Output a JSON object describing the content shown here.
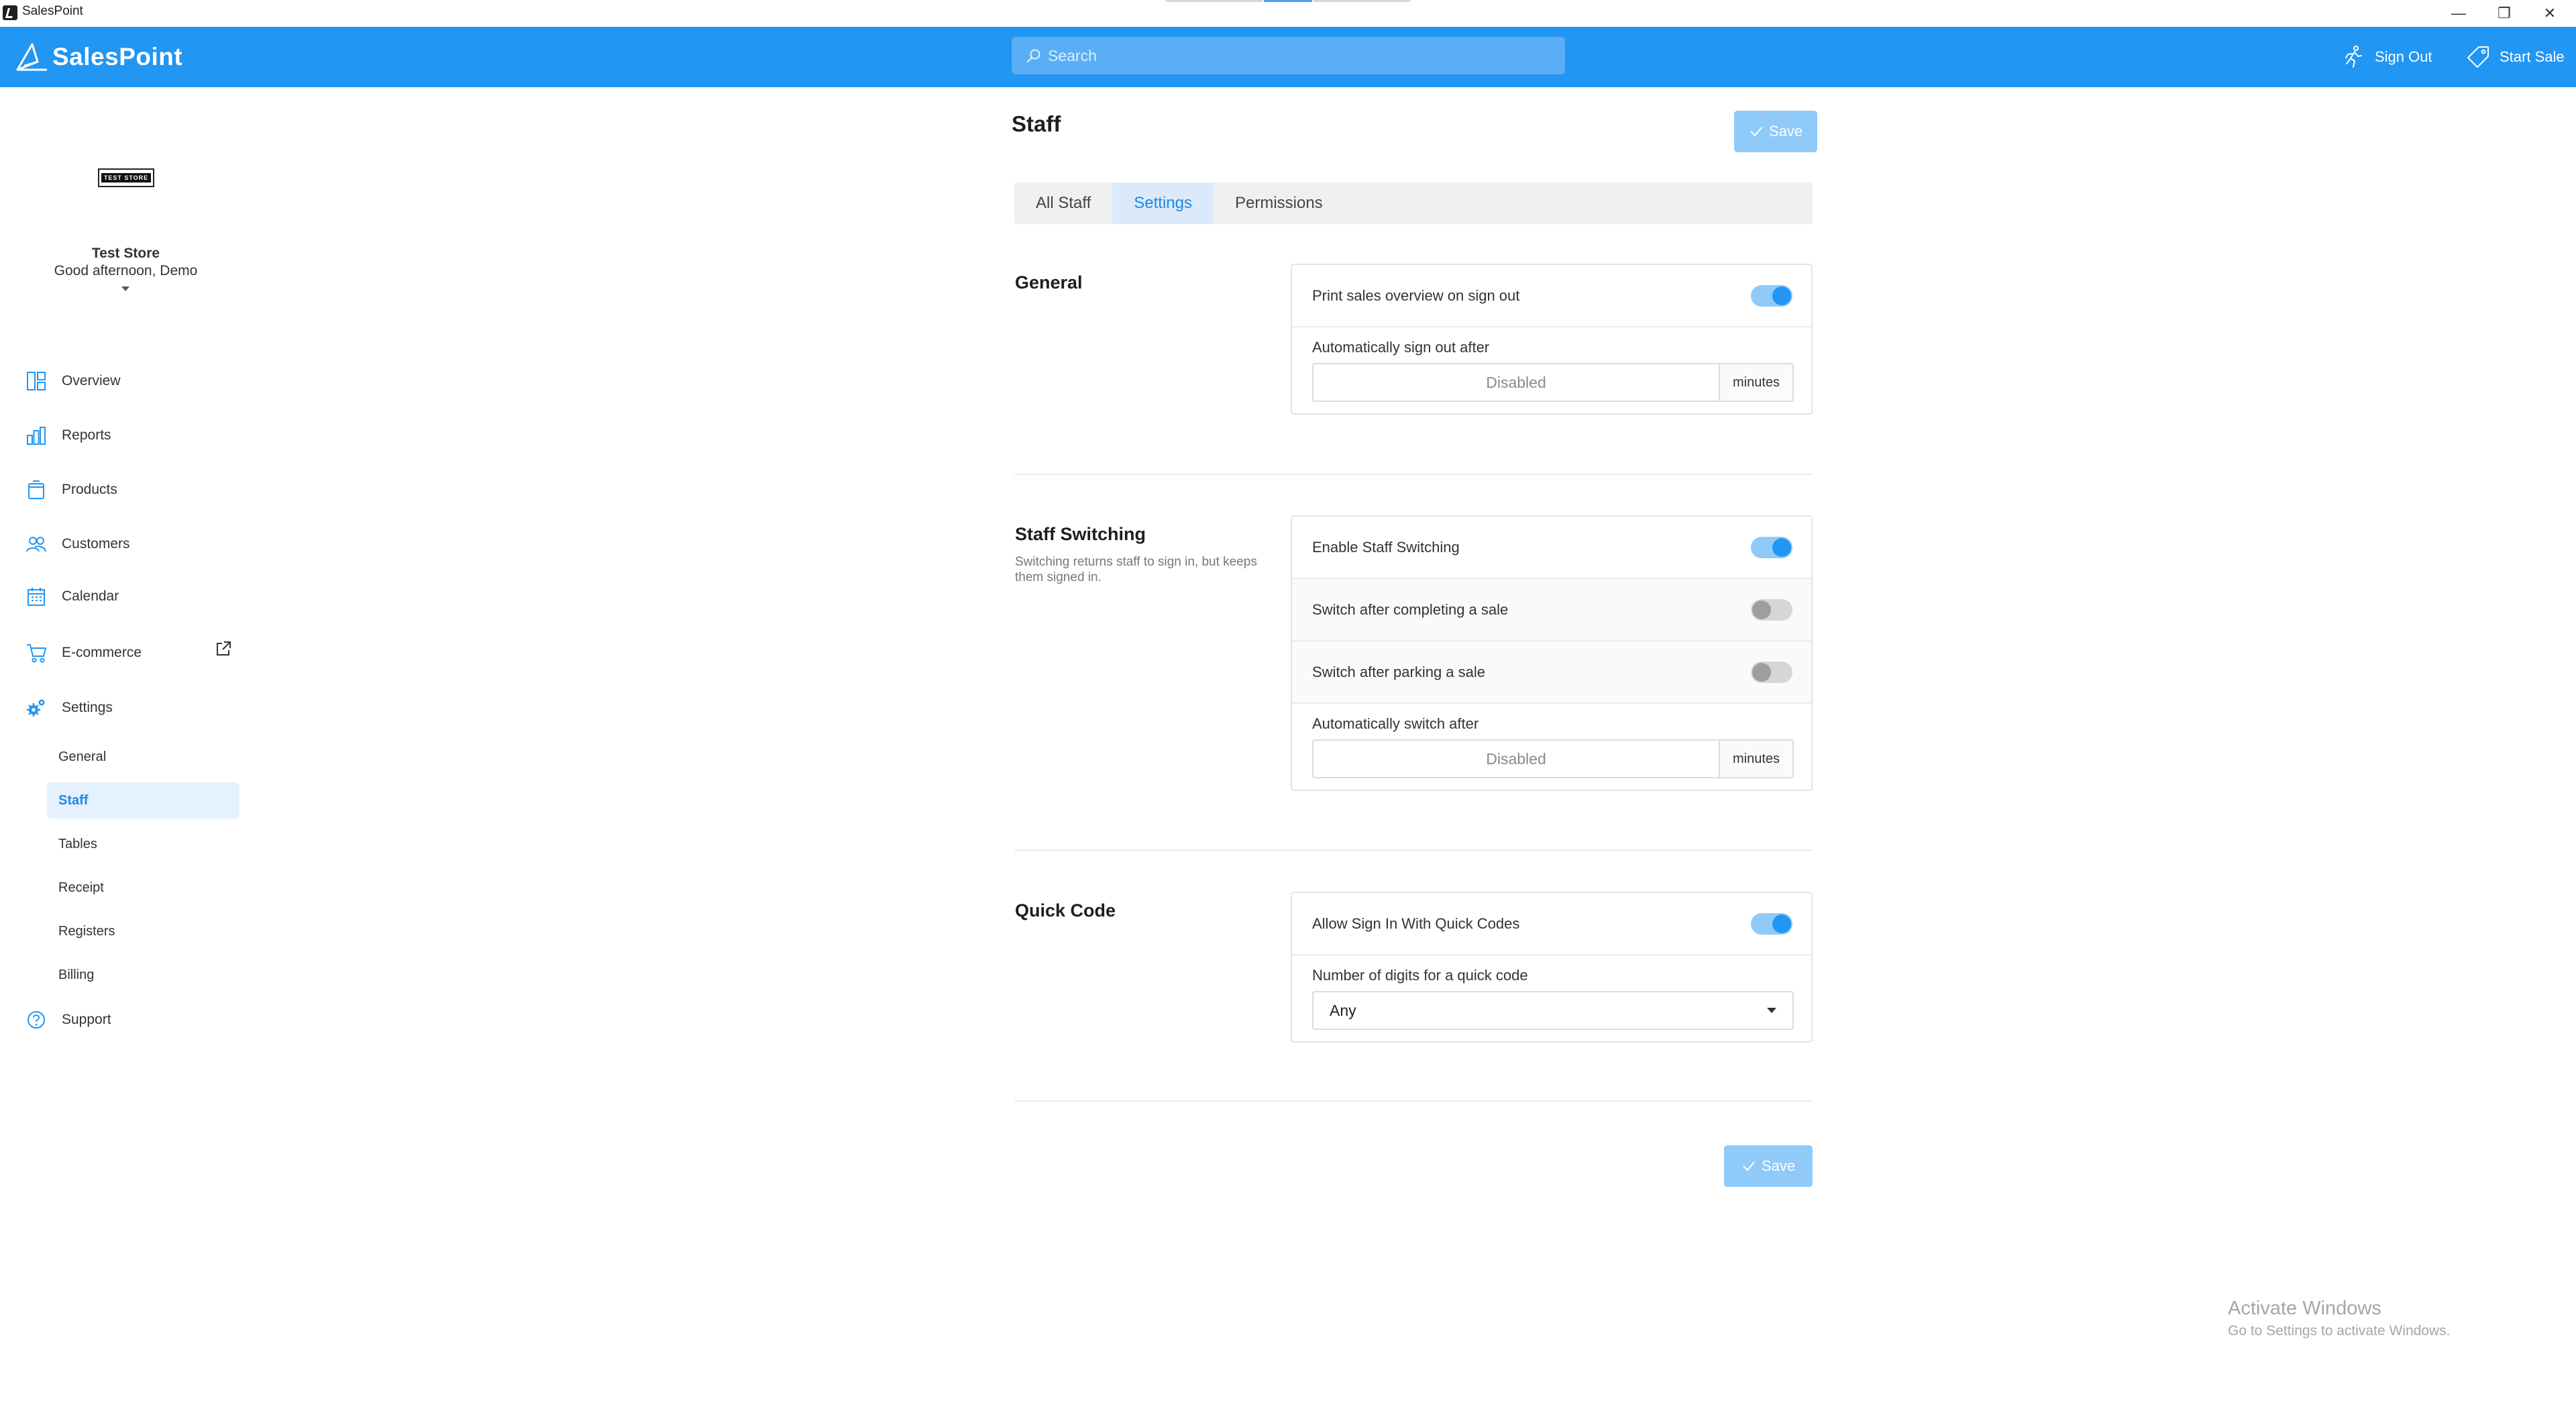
{
  "window": {
    "title": "SalesPoint",
    "controls": {
      "minimize": "—",
      "maximize": "❐",
      "close": "✕"
    }
  },
  "header": {
    "logo_text": "SalesPoint",
    "search_placeholder": "Search",
    "sign_out_label": "Sign Out",
    "start_sale_label": "Start Sale"
  },
  "sidebar": {
    "store_logo_text": "TEST STORE",
    "store_name": "Test Store",
    "greeting": "Good afternoon, Demo",
    "nav": [
      {
        "label": "Overview",
        "icon": "overview-icon"
      },
      {
        "label": "Reports",
        "icon": "reports-icon"
      },
      {
        "label": "Products",
        "icon": "products-icon"
      },
      {
        "label": "Customers",
        "icon": "customers-icon"
      },
      {
        "label": "Calendar",
        "icon": "calendar-icon"
      },
      {
        "label": "E-commerce",
        "icon": "cart-icon"
      },
      {
        "label": "Settings",
        "icon": "gears-icon"
      }
    ],
    "settings_sub": [
      {
        "label": "General",
        "active": false
      },
      {
        "label": "Staff",
        "active": true
      },
      {
        "label": "Tables",
        "active": false
      },
      {
        "label": "Receipt",
        "active": false
      },
      {
        "label": "Registers",
        "active": false
      },
      {
        "label": "Billing",
        "active": false
      }
    ],
    "support_label": "Support"
  },
  "page": {
    "title": "Staff",
    "save_label": "Save",
    "tabs": [
      {
        "label": "All Staff",
        "active": false
      },
      {
        "label": "Settings",
        "active": true
      },
      {
        "label": "Permissions",
        "active": false
      }
    ],
    "general": {
      "title": "General",
      "print_overview_label": "Print sales overview on sign out",
      "print_overview_on": true,
      "auto_signout_label": "Automatically sign out after",
      "auto_signout_value": "Disabled",
      "auto_signout_unit": "minutes"
    },
    "staff_switching": {
      "title": "Staff Switching",
      "description": "Switching returns staff to sign in, but keeps them signed in.",
      "enable_label": "Enable Staff Switching",
      "enable_on": true,
      "after_sale_label": "Switch after completing a sale",
      "after_sale_on": false,
      "after_park_label": "Switch after parking a sale",
      "after_park_on": false,
      "auto_switch_label": "Automatically switch after",
      "auto_switch_value": "Disabled",
      "auto_switch_unit": "minutes"
    },
    "quick_code": {
      "title": "Quick Code",
      "allow_label": "Allow Sign In With Quick Codes",
      "allow_on": true,
      "digits_label": "Number of digits for a quick code",
      "digits_value": "Any"
    }
  },
  "watermark": {
    "title": "Activate Windows",
    "subtitle": "Go to Settings to activate Windows."
  },
  "colors": {
    "brand": "#2196f3",
    "accent_light": "#90caf9",
    "active_bg": "#e5f2fd"
  }
}
